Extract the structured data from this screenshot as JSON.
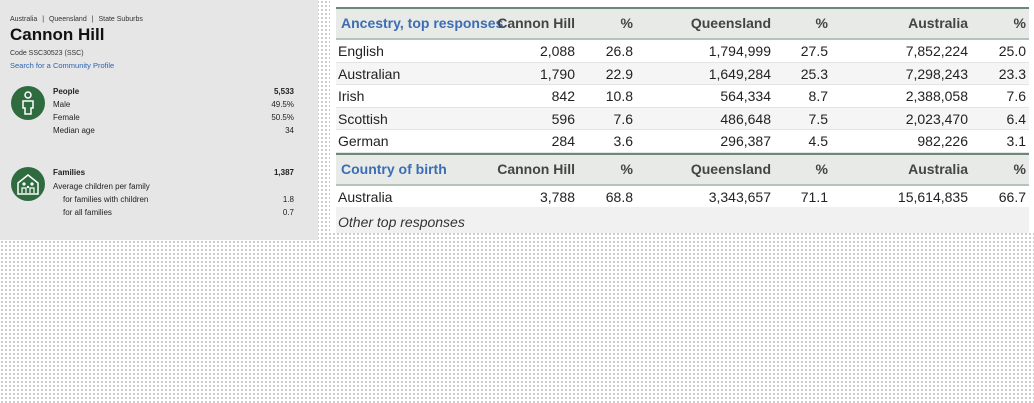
{
  "breadcrumb": [
    "Australia",
    "|",
    "Queensland",
    "|",
    "State Suburbs"
  ],
  "title": "Cannon Hill",
  "code_text": "Code SSC30523 (SSC)",
  "search_link": "Search for a Community Profile",
  "people": {
    "icon": "person-icon",
    "label": "People",
    "value": "5,533",
    "rows": [
      {
        "label": "Male",
        "value": "49.5%"
      },
      {
        "label": "Female",
        "value": "50.5%"
      },
      {
        "label": "Median age",
        "value": "34"
      }
    ]
  },
  "families": {
    "icon": "family-house-icon",
    "label": "Families",
    "value": "1,387",
    "avg_label": "Average children per family",
    "rows": [
      {
        "label": "for families with children",
        "value": "1.8"
      },
      {
        "label": "for all families",
        "value": "0.7"
      }
    ]
  },
  "ancestry": {
    "headers": [
      "Ancestry, top responses",
      "Cannon Hill",
      "%",
      "Queensland",
      "%",
      "Australia",
      "%"
    ],
    "rows": [
      [
        "English",
        "2,088",
        "26.8",
        "1,794,999",
        "27.5",
        "7,852,224",
        "25.0"
      ],
      [
        "Australian",
        "1,790",
        "22.9",
        "1,649,284",
        "25.3",
        "7,298,243",
        "23.3"
      ],
      [
        "Irish",
        "842",
        "10.8",
        "564,334",
        "8.7",
        "2,388,058",
        "7.6"
      ],
      [
        "Scottish",
        "596",
        "7.6",
        "486,648",
        "7.5",
        "2,023,470",
        "6.4"
      ],
      [
        "German",
        "284",
        "3.6",
        "296,387",
        "4.5",
        "982,226",
        "3.1"
      ]
    ]
  },
  "birth": {
    "headers": [
      "Country of birth",
      "Cannon Hill",
      "%",
      "Queensland",
      "%",
      "Australia",
      "%"
    ],
    "rows": [
      [
        "Australia",
        "3,788",
        "68.8",
        "3,343,657",
        "71.1",
        "15,614,835",
        "66.7"
      ]
    ]
  },
  "other_responses": "Other top responses",
  "colors": {
    "accent_green": "#2e6b3f",
    "link_blue": "#2a63b8",
    "header_blue": "#3c6db4"
  }
}
